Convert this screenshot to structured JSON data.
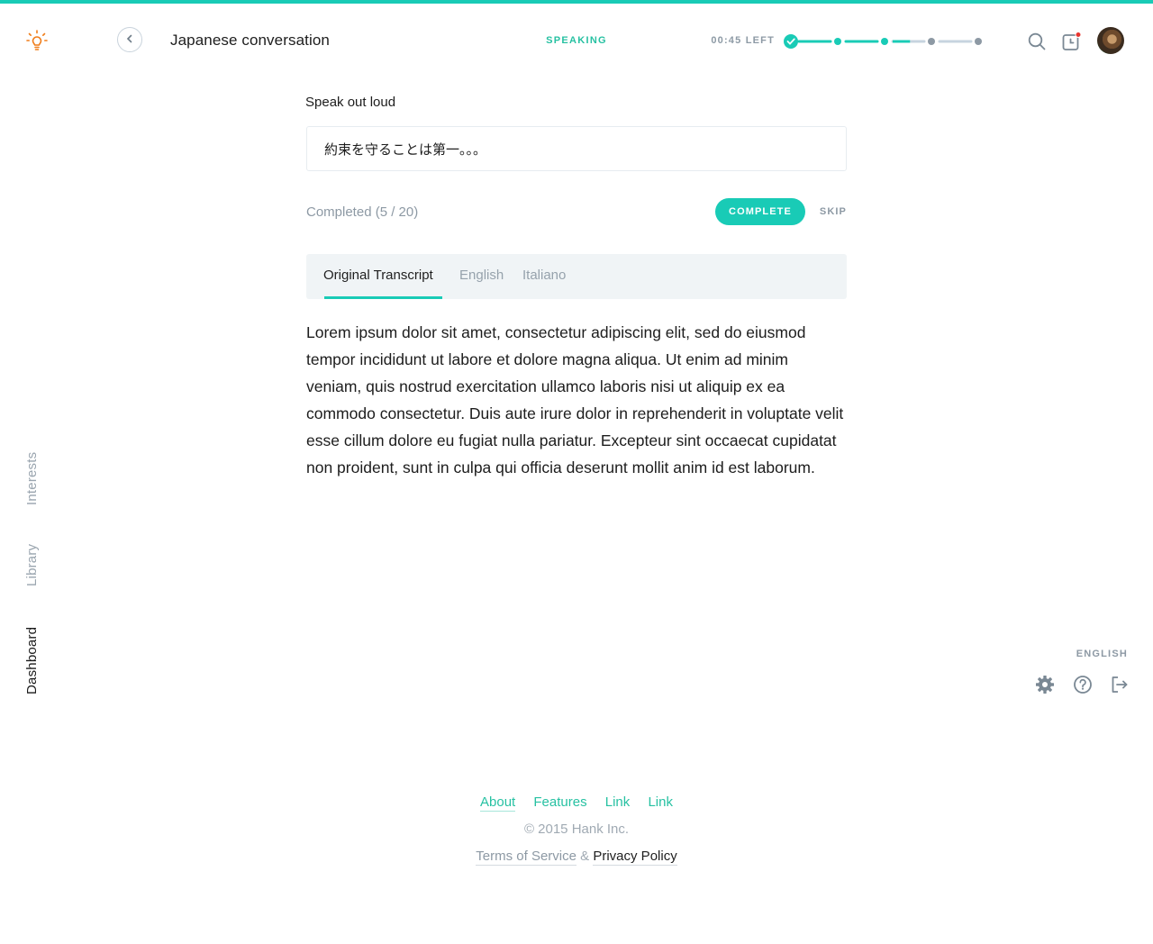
{
  "header": {
    "title": "Japanese conversation",
    "mode": "SPEAKING",
    "time_left": "00:45 LEFT",
    "progress_stages": 5,
    "progress_completed": 3
  },
  "side_nav": {
    "items": [
      {
        "label": "Interests"
      },
      {
        "label": "Library"
      },
      {
        "label": "Dashboard"
      }
    ],
    "active": "Dashboard"
  },
  "exercise": {
    "prompt_label": "Speak out loud",
    "prompt_text": "約束を守ることは第一。。。",
    "completed_text": "Completed (5 / 20)",
    "complete_label": "COMPLETE",
    "skip_label": "SKIP"
  },
  "tabs": [
    {
      "label": "Original Transcript"
    },
    {
      "label": "English"
    },
    {
      "label": "Italiano"
    }
  ],
  "transcript": "Lorem ipsum dolor sit amet, consectetur adipiscing elit, sed do eiusmod tempor incididunt ut labore et dolore magna aliqua. Ut enim ad minim veniam, quis nostrud exercitation ullamco laboris nisi ut aliquip ex ea commodo consectetur. Duis aute irure dolor in reprehenderit in voluptate velit esse cillum dolore eu fugiat nulla pariatur. Excepteur sint occaecat cupidatat non proident, sunt in culpa qui officia deserunt mollit anim id est laborum.",
  "utilities": {
    "language": "ENGLISH"
  },
  "footer": {
    "links": [
      {
        "label": "About"
      },
      {
        "label": "Features"
      },
      {
        "label": "Link"
      },
      {
        "label": "Link"
      }
    ],
    "copyright": "© 2015 Hank Inc.",
    "terms": "Terms of Service",
    "ampersand": "&",
    "privacy": "Privacy Policy"
  },
  "colors": {
    "accent": "#19cbb6",
    "accent_text": "#27c1a2",
    "logo": "#f07d1a",
    "notification": "#e8352f",
    "muted": "#8d99a4"
  },
  "icons": [
    "lightbulb-logo-icon",
    "chevron-left-icon",
    "check-icon",
    "search-icon",
    "history-icon",
    "gear-icon",
    "help-icon",
    "logout-icon"
  ]
}
